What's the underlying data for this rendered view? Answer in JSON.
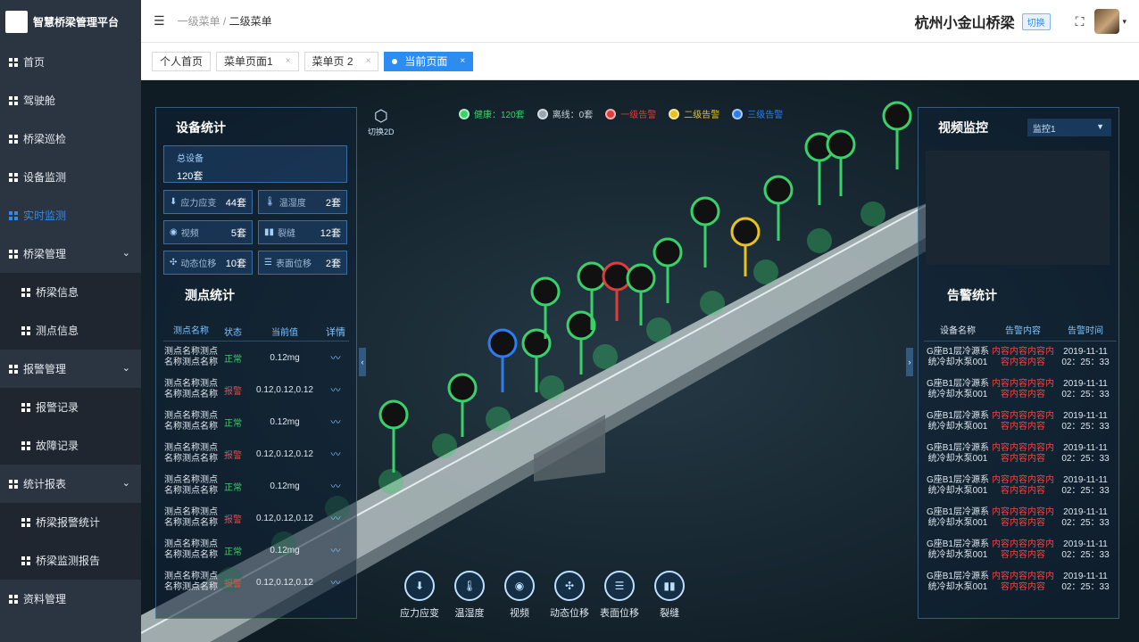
{
  "app": {
    "title": "智慧桥梁管理平台"
  },
  "sidebar": {
    "items": [
      {
        "label": "首页"
      },
      {
        "label": "驾驶舱"
      },
      {
        "label": "桥梁巡检"
      },
      {
        "label": "设备监测"
      },
      {
        "label": "实时监测",
        "active": true
      },
      {
        "label": "桥梁管理",
        "expanded": true
      },
      {
        "label": "桥梁信息"
      },
      {
        "label": "测点信息"
      },
      {
        "label": "报警管理",
        "expanded": true
      },
      {
        "label": "报警记录"
      },
      {
        "label": "故障记录"
      },
      {
        "label": "统计报表",
        "expanded": true
      },
      {
        "label": "桥梁报警统计"
      },
      {
        "label": "桥梁监测报告"
      },
      {
        "label": "资料管理"
      }
    ]
  },
  "header": {
    "breadcrumb_level1": "一级菜单",
    "breadcrumb_sep": " / ",
    "breadcrumb_level2": "二级菜单",
    "bridge_name": "杭州小金山桥梁",
    "switch_label": "切换"
  },
  "tabs": [
    {
      "label": "个人首页",
      "closable": false
    },
    {
      "label": "菜单页面1",
      "closable": true
    },
    {
      "label": "菜单页 2",
      "closable": true
    },
    {
      "label": "当前页面",
      "closable": true,
      "active": true
    }
  ],
  "map": {
    "switch_2d": "切换2D",
    "legend": [
      {
        "label": "健康：120套",
        "color": "#3ad16a"
      },
      {
        "label": "离线：0套",
        "color": "#9aa6b2"
      },
      {
        "label": "一级告警",
        "color": "#e23b3b"
      },
      {
        "label": "二级告警",
        "color": "#e8c21f"
      },
      {
        "label": "三级告警",
        "color": "#2d7cf0"
      }
    ],
    "bottom_buttons": [
      "应力应变",
      "温湿度",
      "视频",
      "动态位移",
      "表面位移",
      "裂缝"
    ]
  },
  "device_stats": {
    "title": "设备统计",
    "total_label": "总设备",
    "total_value": "120套",
    "items": [
      {
        "label": "应力应变",
        "count": "44套"
      },
      {
        "label": "温湿度",
        "count": "2套"
      },
      {
        "label": "视频",
        "count": "5套"
      },
      {
        "label": "裂缝",
        "count": "12套"
      },
      {
        "label": "动态位移",
        "count": "10套"
      },
      {
        "label": "表面位移",
        "count": "2套"
      }
    ]
  },
  "point_stats": {
    "title": "测点统计",
    "headers": [
      "测点名称",
      "状态",
      "当前值",
      "详情"
    ],
    "rows": [
      {
        "name": "测点名称测点名称测点名称",
        "status": "正常",
        "value": "0.12mg",
        "ok": true
      },
      {
        "name": "测点名称测点名称测点名称",
        "status": "报警",
        "value": "0.12,0.12,0.12",
        "ok": false
      },
      {
        "name": "测点名称测点名称测点名称",
        "status": "正常",
        "value": "0.12mg",
        "ok": true
      },
      {
        "name": "测点名称测点名称测点名称",
        "status": "报警",
        "value": "0.12,0.12,0.12",
        "ok": false
      },
      {
        "name": "测点名称测点名称测点名称",
        "status": "正常",
        "value": "0.12mg",
        "ok": true
      },
      {
        "name": "测点名称测点名称测点名称",
        "status": "报警",
        "value": "0.12,0.12,0.12",
        "ok": false
      },
      {
        "name": "测点名称测点名称测点名称",
        "status": "正常",
        "value": "0.12mg",
        "ok": true
      },
      {
        "name": "测点名称测点名称测点名称",
        "status": "报警",
        "value": "0.12,0.12,0.12",
        "ok": false
      }
    ]
  },
  "video_monitor": {
    "title": "视频监控",
    "selected": "监控1"
  },
  "alarm_stats": {
    "title": "告警统计",
    "headers": [
      "设备名称",
      "告警内容",
      "告警时间"
    ],
    "rows": [
      {
        "device": "G座B1层冷源系统冷却水泵001",
        "content": "内容内容内容内容内容内容",
        "time": "2019-11-11 02：25：33"
      },
      {
        "device": "G座B1层冷源系统冷却水泵001",
        "content": "内容内容内容内容内容内容",
        "time": "2019-11-11 02：25：33"
      },
      {
        "device": "G座B1层冷源系统冷却水泵001",
        "content": "内容内容内容内容内容内容",
        "time": "2019-11-11 02：25：33"
      },
      {
        "device": "G座B1层冷源系统冷却水泵001",
        "content": "内容内容内容内容内容内容",
        "time": "2019-11-11 02：25：33"
      },
      {
        "device": "G座B1层冷源系统冷却水泵001",
        "content": "内容内容内容内容内容内容",
        "time": "2019-11-11 02：25：33"
      },
      {
        "device": "G座B1层冷源系统冷却水泵001",
        "content": "内容内容内容内容内容内容",
        "time": "2019-11-11 02：25：33"
      },
      {
        "device": "G座B1层冷源系统冷却水泵001",
        "content": "内容内容内容内容内容内容",
        "time": "2019-11-11 02：25：33"
      },
      {
        "device": "G座B1层冷源系统冷却水泵001",
        "content": "内容内容内容内容内容内容",
        "time": "2019-11-11 02：25：33"
      }
    ]
  }
}
